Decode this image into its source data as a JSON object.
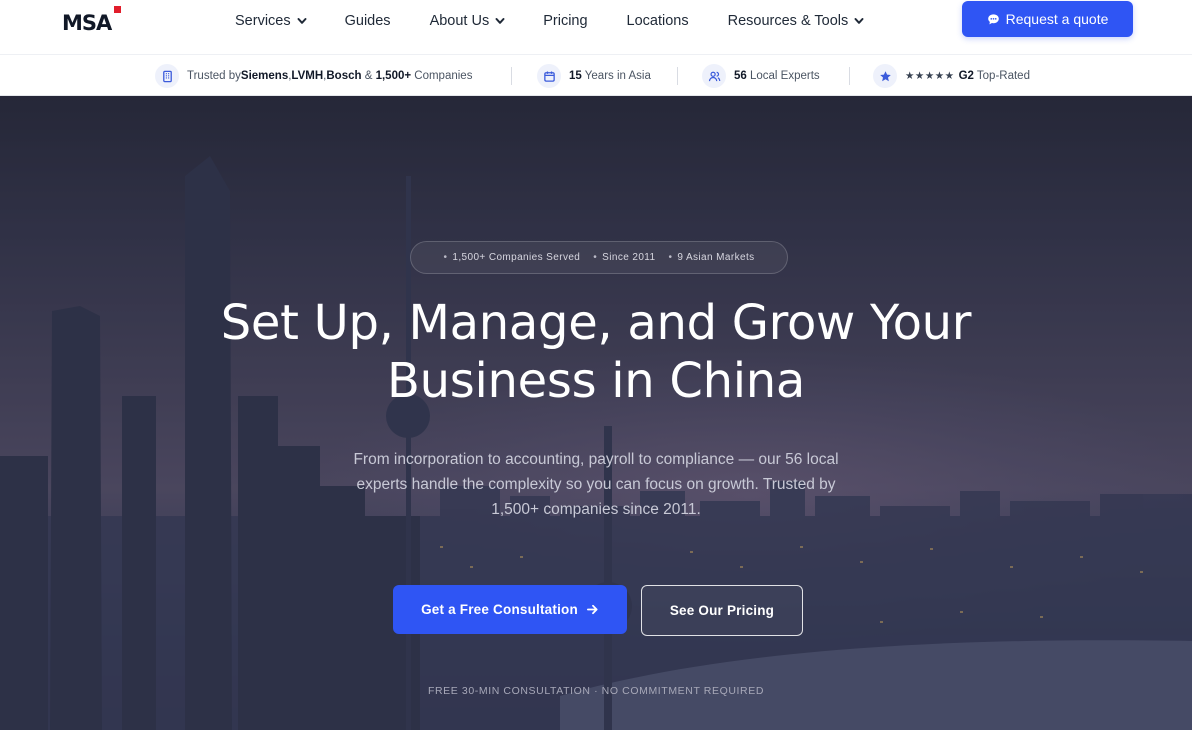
{
  "nav": {
    "logo": "MSA",
    "menu": [
      {
        "label": "Services",
        "dropdown": true
      },
      {
        "label": "Guides",
        "dropdown": false
      },
      {
        "label": "About Us",
        "dropdown": true
      },
      {
        "label": "Pricing",
        "dropdown": false
      },
      {
        "label": "Locations",
        "dropdown": false
      },
      {
        "label": "Resources & Tools",
        "dropdown": true
      }
    ],
    "cta_label": "Request a quote"
  },
  "trust_bar": {
    "item1": {
      "prefix": "Trusted by ",
      "brand1": "Siemens",
      "sep1": ", ",
      "brand2": "LVMH",
      "sep2": ", ",
      "brand3": "Bosch",
      "amp": " & ",
      "count": "1,500+",
      "suffix": " Companies"
    },
    "item2": {
      "bold": "15",
      "text": " Years in Asia"
    },
    "item3": {
      "bold": "56",
      "text": " Local Experts"
    },
    "item4": {
      "stars": "★★★★★",
      "bold": "G2",
      "text": " Top-Rated"
    }
  },
  "hero": {
    "pill": [
      "1,500+ Companies Served",
      "Since 2011",
      "9 Asian Markets"
    ],
    "title_line1": "Set Up, Manage, and Grow Your",
    "title_line2": "Business in China",
    "subtitle": "From incorporation to accounting, payroll to compliance — our 56 local experts handle the complexity so you can focus on growth. Trusted by 1,500+ companies since 2011.",
    "primary_cta": "Get a Free Consultation",
    "secondary_cta": "See Our Pricing",
    "note": "FREE 30-MIN CONSULTATION · NO COMMITMENT REQUIRED"
  },
  "colors": {
    "accent": "#2f55f4",
    "logo_mark": "#e11d2b"
  }
}
